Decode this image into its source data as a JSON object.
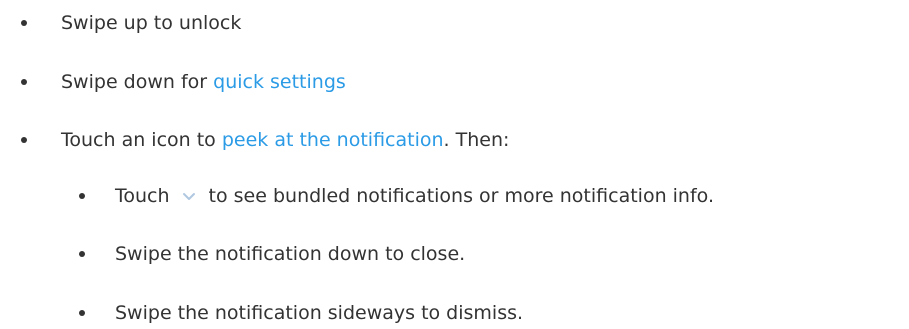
{
  "colors": {
    "text": "#333333",
    "link": "#2b9be6",
    "icon": "#b0c8e0"
  },
  "items": [
    {
      "text": "Swipe up to unlock"
    },
    {
      "prefix": "Swipe down for ",
      "link": "quick settings"
    },
    {
      "prefix": "Touch an icon to ",
      "link": "peek at the notification",
      "suffix": ". Then:"
    }
  ],
  "sub_items": [
    {
      "prefix": "Touch",
      "icon": "chevron-down-icon",
      "suffix": "to see bundled notifications or more notification info."
    },
    {
      "text": "Swipe the notification down to close."
    },
    {
      "text": "Swipe the notification sideways to dismiss."
    }
  ]
}
